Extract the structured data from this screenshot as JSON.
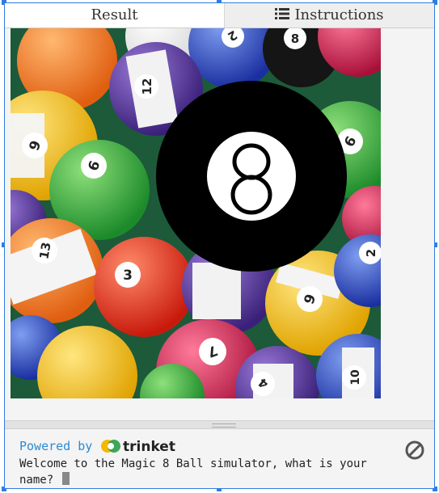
{
  "tabs": [
    {
      "label": "Result",
      "active": true
    },
    {
      "label": "Instructions",
      "icon": "list-icon",
      "active": false
    }
  ],
  "canvas": {
    "background": "billiard-balls-image",
    "eight_ball": {
      "number": "8",
      "colors": {
        "outer": "#000000",
        "inner": "#ffffff"
      }
    }
  },
  "console": {
    "powered_by": "Powered by",
    "brand": "trinket",
    "output": "Welcome to the Magic 8 Ball simulator, what is your\nname? ",
    "stop_icon": "stop-icon"
  },
  "colors": {
    "accent": "#2f7de1",
    "link": "#2a8ad4"
  }
}
